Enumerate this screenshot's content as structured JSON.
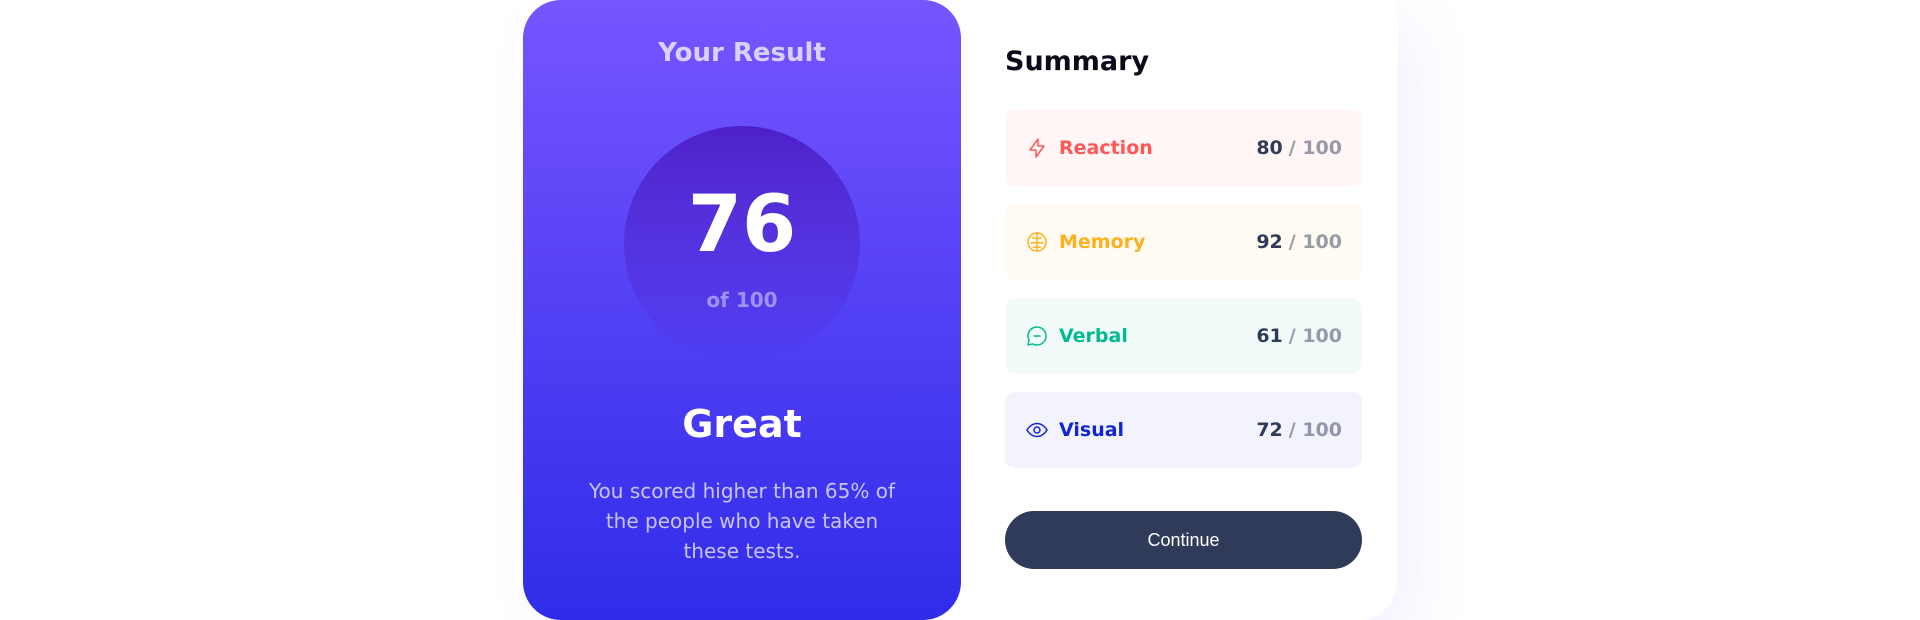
{
  "result": {
    "title": "Your Result",
    "score": "76",
    "of": "of 100",
    "grade": "Great",
    "description": "You scored higher than 65% of the people who have taken these tests."
  },
  "summary": {
    "title": "Summary",
    "items": [
      {
        "label": "Reaction",
        "score": "80",
        "out_of": "/ 100",
        "icon": "lightning-icon",
        "color": "#ff5757"
      },
      {
        "label": "Memory",
        "score": "92",
        "out_of": "/ 100",
        "icon": "brain-icon",
        "color": "#ffb01f"
      },
      {
        "label": "Verbal",
        "score": "61",
        "out_of": "/ 100",
        "icon": "chat-bubble-icon",
        "color": "#00bb8f"
      },
      {
        "label": "Visual",
        "score": "72",
        "out_of": "/ 100",
        "icon": "eye-icon",
        "color": "#1125d4"
      }
    ],
    "continue_label": "Continue"
  },
  "colors": {
    "gradient_top": "#7755ff",
    "gradient_bottom": "#2f2ce9",
    "button": "#303b5a"
  }
}
